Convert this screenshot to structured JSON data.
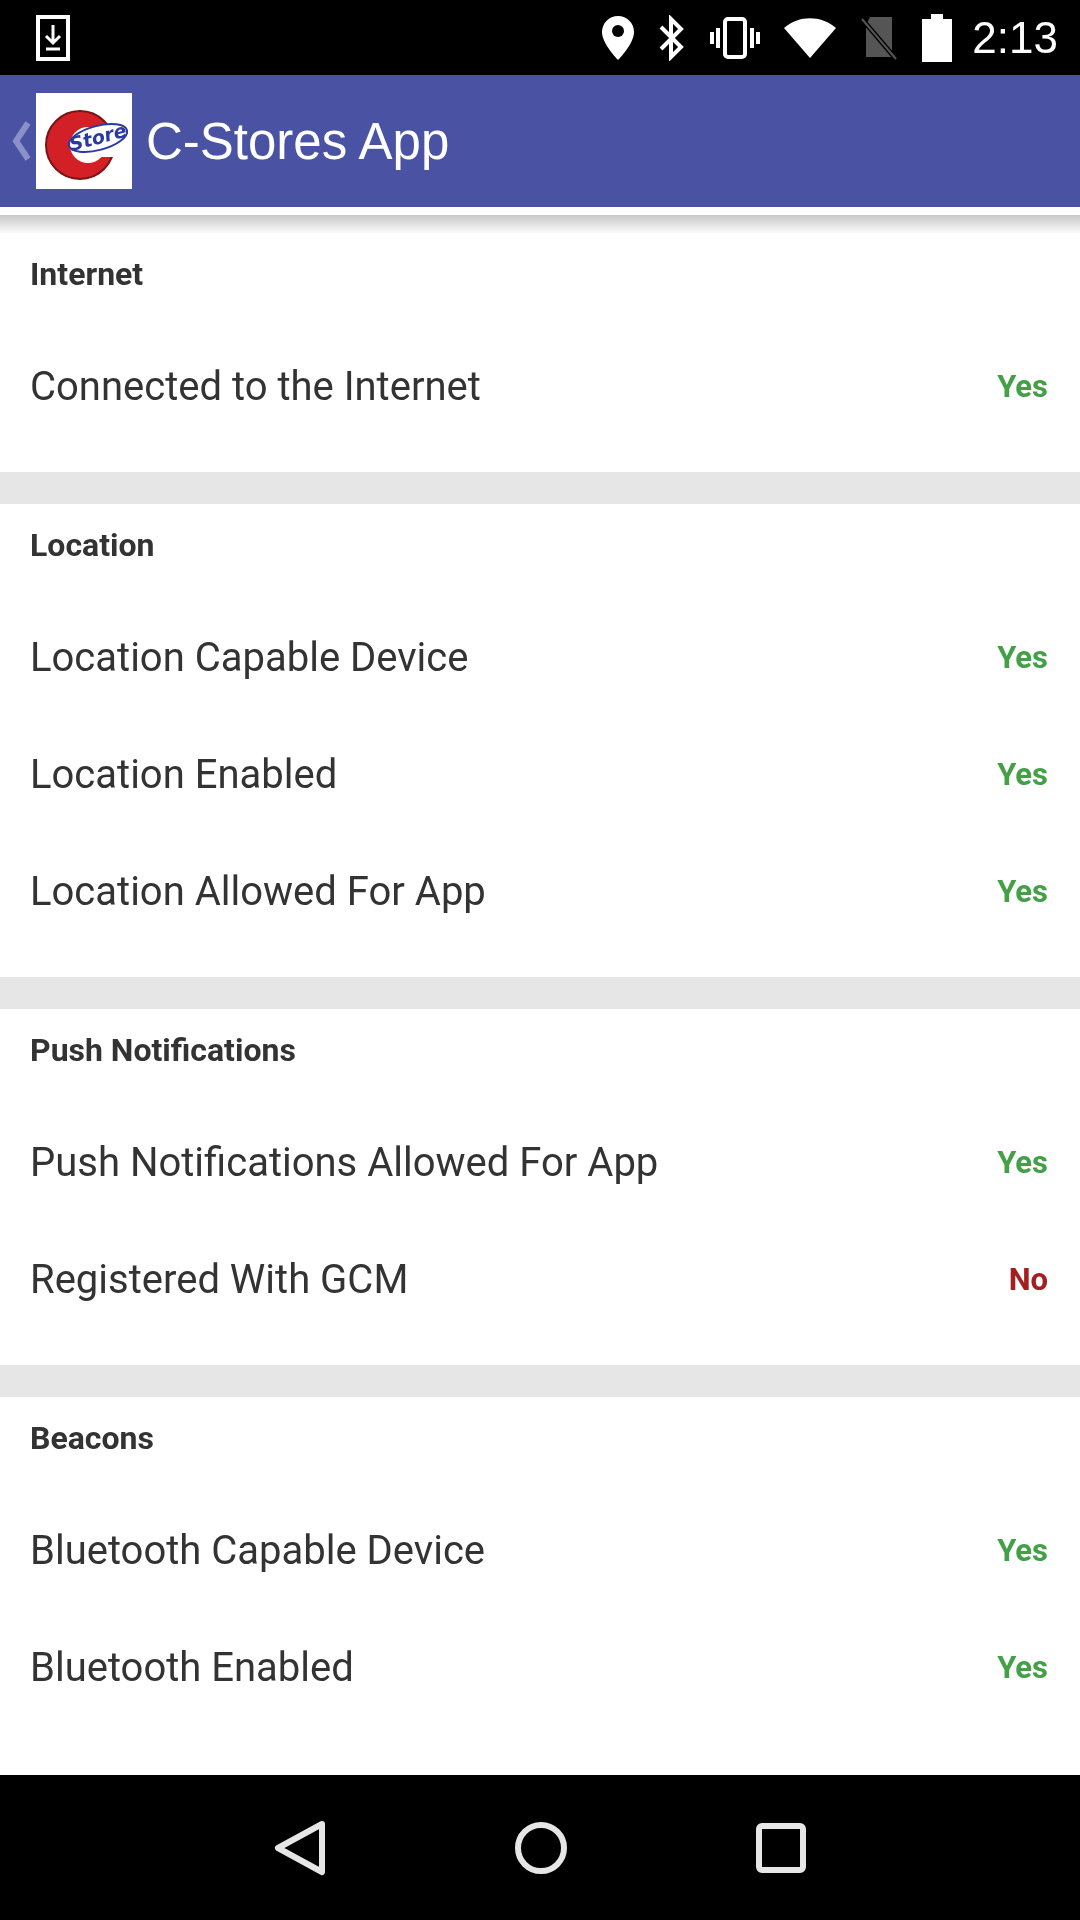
{
  "status_bar": {
    "time": "2:13"
  },
  "app_bar": {
    "logo_text": "Store",
    "title": "C-Stores App"
  },
  "sections": [
    {
      "header": "Internet",
      "rows": [
        {
          "label": "Connected to the Internet",
          "value": "Yes",
          "ok": true
        }
      ]
    },
    {
      "header": "Location",
      "rows": [
        {
          "label": "Location Capable Device",
          "value": "Yes",
          "ok": true
        },
        {
          "label": "Location Enabled",
          "value": "Yes",
          "ok": true
        },
        {
          "label": "Location Allowed For App",
          "value": "Yes",
          "ok": true
        }
      ]
    },
    {
      "header": "Push Notifications",
      "rows": [
        {
          "label": "Push Notifications Allowed For App",
          "value": "Yes",
          "ok": true
        },
        {
          "label": "Registered With GCM",
          "value": "No",
          "ok": false
        }
      ]
    },
    {
      "header": "Beacons",
      "rows": [
        {
          "label": "Bluetooth Capable Device",
          "value": "Yes",
          "ok": true
        },
        {
          "label": "Bluetooth Enabled",
          "value": "Yes",
          "ok": true
        }
      ]
    }
  ]
}
